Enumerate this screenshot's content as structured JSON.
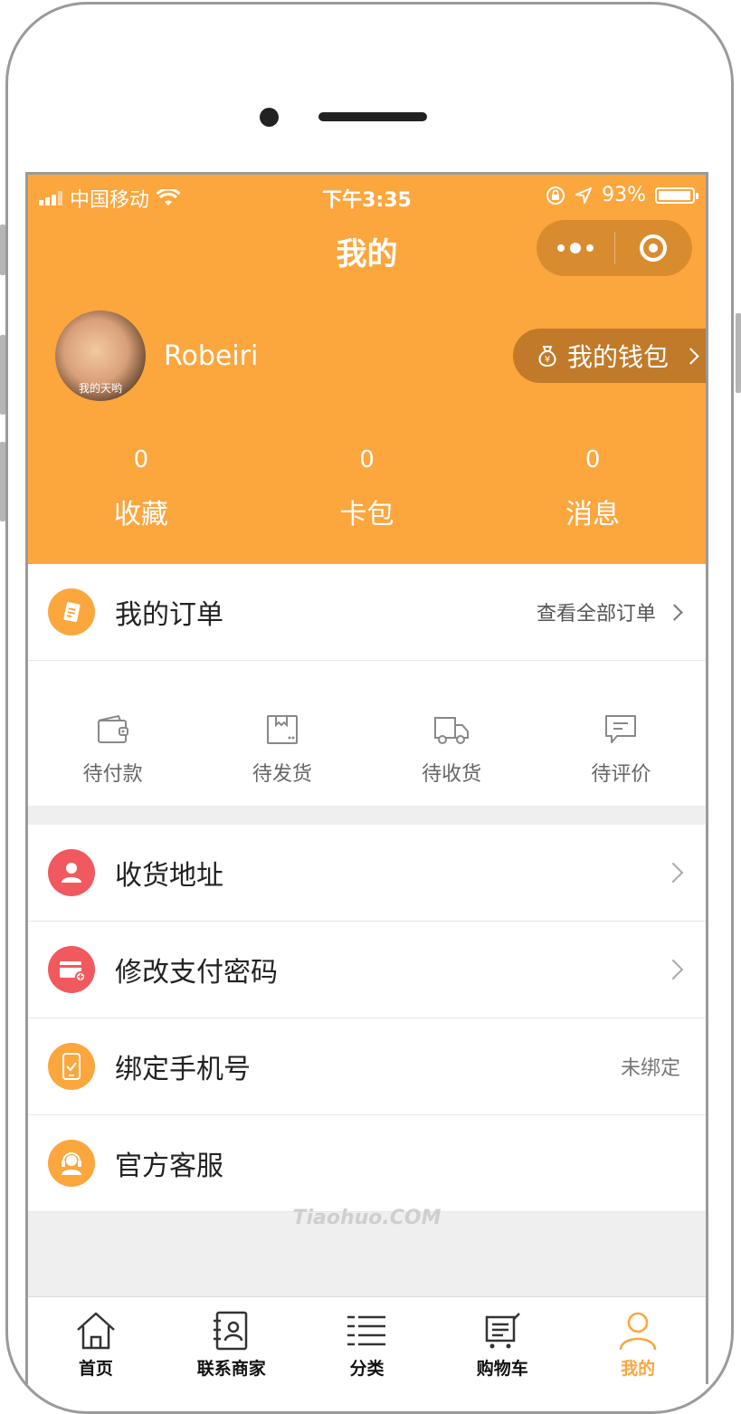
{
  "status_bar": {
    "carrier": "中国移动",
    "time": "下午3:35",
    "battery": "93%"
  },
  "nav": {
    "title": "我的"
  },
  "profile": {
    "username": "Robeiri",
    "avatar_caption": "我的天哟",
    "wallet_label": "我的钱包"
  },
  "stats": [
    {
      "count": "0",
      "label": "收藏"
    },
    {
      "count": "0",
      "label": "卡包"
    },
    {
      "count": "0",
      "label": "消息"
    }
  ],
  "orders": {
    "title": "我的订单",
    "view_all": "查看全部订单",
    "statuses": [
      {
        "label": "待付款",
        "icon": "wallet-icon"
      },
      {
        "label": "待发货",
        "icon": "package-icon"
      },
      {
        "label": "待收货",
        "icon": "truck-icon"
      },
      {
        "label": "待评价",
        "icon": "comment-icon"
      }
    ]
  },
  "menu": [
    {
      "label": "收货地址",
      "icon": "person-icon",
      "color": "#F0595E"
    },
    {
      "label": "修改支付密码",
      "icon": "card-icon",
      "color": "#F0595E"
    },
    {
      "label": "绑定手机号",
      "icon": "phone-icon",
      "color": "#FCA63E",
      "value": "未绑定"
    },
    {
      "label": "官方客服",
      "icon": "headset-icon",
      "color": "#FCA63E"
    }
  ],
  "watermark": "Tiaohuo.COM",
  "tabbar": [
    {
      "label": "首页",
      "icon": "home-icon"
    },
    {
      "label": "联系商家",
      "icon": "contact-icon"
    },
    {
      "label": "分类",
      "icon": "category-icon"
    },
    {
      "label": "购物车",
      "icon": "cart-icon"
    },
    {
      "label": "我的",
      "icon": "profile-icon",
      "active": true
    }
  ],
  "colors": {
    "accent": "#FCA63E",
    "wallet_bg": "#C07A2A",
    "red_icon": "#F0595E"
  }
}
